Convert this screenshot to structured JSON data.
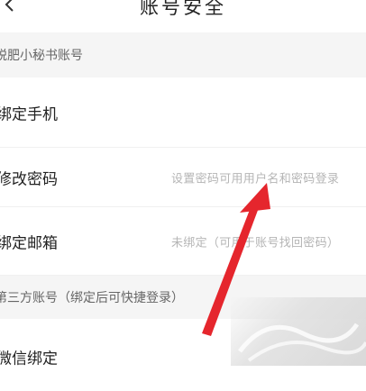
{
  "header": {
    "title": "账号安全"
  },
  "sections": [
    {
      "label": "脱肥小秘书账号"
    },
    {
      "label": "第三方账号（绑定后可快捷登录）"
    }
  ],
  "rows": [
    {
      "label": "绑定手机",
      "hint": ""
    },
    {
      "label": "修改密码",
      "hint": "设置密码可用用户名和密码登录"
    },
    {
      "label": "绑定邮箱",
      "hint": "未绑定（可用于账号找回密码）"
    },
    {
      "label": "微信绑定",
      "hint": ""
    }
  ],
  "colors": {
    "section_bg": "#f5f5f5",
    "hint_text": "#b5b5b5",
    "arrow": "#e5262d"
  }
}
